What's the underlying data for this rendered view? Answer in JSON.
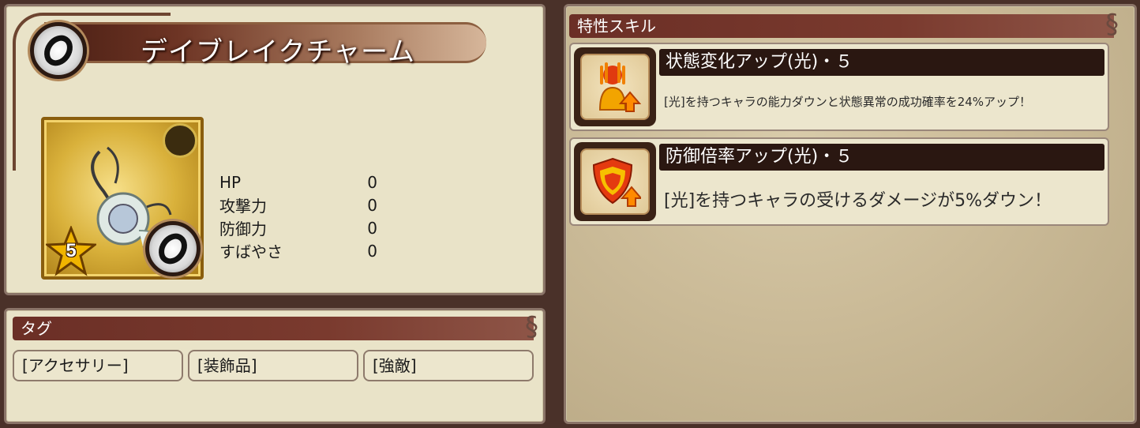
{
  "item": {
    "name": "デイブレイクチャーム",
    "rarity": "5",
    "stats": [
      {
        "label": "HP",
        "value": "0"
      },
      {
        "label": "攻撃力",
        "value": "0"
      },
      {
        "label": "防御力",
        "value": "0"
      },
      {
        "label": "すばやさ",
        "value": "0"
      }
    ]
  },
  "tags": {
    "header": "タグ",
    "items": [
      "[アクセサリー]",
      "[装飾品]",
      "[強敵]"
    ]
  },
  "skills": {
    "header": "特性スキル",
    "items": [
      {
        "name": "状態変化アップ(光)・５",
        "description": "[光]を持つキャラの能力ダウンと状態異常の成功確率を24%アップ！",
        "icon": "status-up-hand-icon"
      },
      {
        "name": "防御倍率アップ(光)・５",
        "description": "[光]を持つキャラの受けるダメージが5%ダウン！",
        "icon": "shield-up-icon"
      }
    ]
  },
  "colors": {
    "background": "#4a3129",
    "panel": "#e9e3c8",
    "header": "#6b2f26",
    "skill_name_bar": "#2a1711",
    "portrait_gold": "#d9b13b"
  }
}
